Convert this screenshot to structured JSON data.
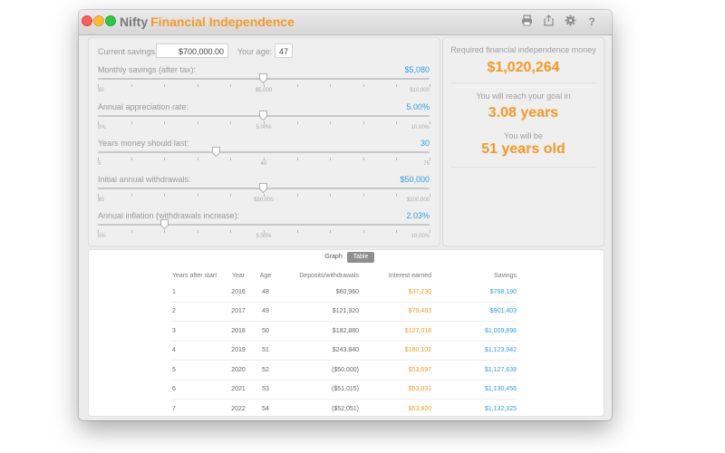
{
  "window": {
    "title_part1": "Nifty",
    "title_part2": "Financial Independence"
  },
  "toolbar_icons": [
    "print-icon",
    "share-icon",
    "gear-icon",
    "help-icon"
  ],
  "inputs": {
    "current_savings_label": "Current savings:",
    "current_savings_value": "$700,000.00",
    "age_label": "Your age:",
    "age_value": "47"
  },
  "sliders": [
    {
      "label": "Monthly savings (after tax):",
      "value": "$5,080",
      "position": 0.5,
      "ticks": [
        "$0",
        "$5,000",
        "$10,000"
      ]
    },
    {
      "label": "Annual appreciation rate:",
      "value": "5.00%",
      "position": 0.5,
      "ticks": [
        "0%",
        "5.00%",
        "10.00%"
      ]
    },
    {
      "label": "Years money should last:",
      "value": "30",
      "position": 0.357,
      "ticks": [
        "5",
        "40",
        "75"
      ]
    },
    {
      "label": "Initial annual withdrawals:",
      "value": "$50,000",
      "position": 0.5,
      "ticks": [
        "$0",
        "$50,000",
        "$100,000"
      ]
    },
    {
      "label": "Annual inflation (withdrawals increase):",
      "value": "2.03%",
      "position": 0.203,
      "ticks": [
        "0%",
        "5.00%",
        "10.00%"
      ]
    }
  ],
  "results": {
    "required_label": "Required financial independence money",
    "required_value": "$1,020,264",
    "reach_label": "You will reach your goal in",
    "reach_value": "3.08 years",
    "age_label": "You will be",
    "age_value": "51 years old"
  },
  "view_toggle": {
    "graph": "Graph",
    "table": "Table",
    "selected": "Table"
  },
  "table": {
    "headers": [
      "Years after start",
      "Year",
      "Age",
      "Deposits/withdrawals",
      "Interest earned",
      "Savings"
    ],
    "rows": [
      [
        "1",
        "2016",
        "48",
        "$60,960",
        "$37,230",
        "$798,190"
      ],
      [
        "2",
        "2017",
        "49",
        "$121,920",
        "$79,483",
        "$901,403"
      ],
      [
        "3",
        "2018",
        "50",
        "$182,880",
        "$127,018",
        "$1,009,898"
      ],
      [
        "4",
        "2019",
        "51",
        "$243,840",
        "$180,102",
        "$1,123,942"
      ],
      [
        "5",
        "2020",
        "52",
        "($50,000)",
        "$53,697",
        "$1,127,639"
      ],
      [
        "6",
        "2021",
        "53",
        "($51,015)",
        "$53,831",
        "$1,130,456"
      ],
      [
        "7",
        "2022",
        "54",
        "($52,051)",
        "$53,920",
        "$1,132,325"
      ]
    ]
  },
  "colors": {
    "accent_orange": "#f39a25",
    "accent_blue": "#2f9ee0"
  }
}
